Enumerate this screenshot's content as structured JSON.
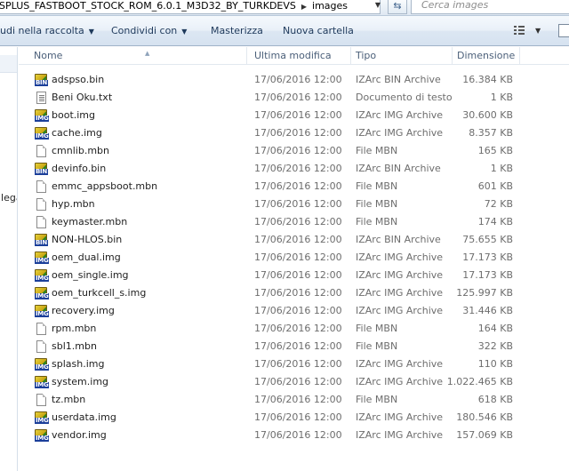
{
  "address": {
    "path_segments": [
      "SPLUS_FASTBOOT_STOCK_ROM_6.0.1_M3D32_BY_TURKDEVS",
      "images"
    ],
    "search_placeholder": "Cerca images"
  },
  "toolbar": {
    "include_label": "udi nella raccolta",
    "share_label": "Condividi con",
    "burn_label": "Masterizza",
    "new_folder_label": "Nuova cartella"
  },
  "nav": {
    "partial_label": "llega"
  },
  "columns": {
    "name": "Nome",
    "modified": "Ultima modifica",
    "type": "Tipo",
    "size": "Dimensione"
  },
  "files": [
    {
      "name": "adspso.bin",
      "date": "17/06/2016 12:00",
      "type": "IZArc BIN Archive",
      "size": "16.384 KB",
      "icon": "izarc-bin-icon"
    },
    {
      "name": "Beni Oku.txt",
      "date": "17/06/2016 12:00",
      "type": "Documento di testo",
      "size": "1 KB",
      "icon": "text-document-icon"
    },
    {
      "name": "boot.img",
      "date": "17/06/2016 12:00",
      "type": "IZArc IMG Archive",
      "size": "30.600 KB",
      "icon": "izarc-img-icon"
    },
    {
      "name": "cache.img",
      "date": "17/06/2016 12:00",
      "type": "IZArc IMG Archive",
      "size": "8.357 KB",
      "icon": "izarc-img-icon"
    },
    {
      "name": "cmnlib.mbn",
      "date": "17/06/2016 12:00",
      "type": "File MBN",
      "size": "165 KB",
      "icon": "file-icon"
    },
    {
      "name": "devinfo.bin",
      "date": "17/06/2016 12:00",
      "type": "IZArc BIN Archive",
      "size": "1 KB",
      "icon": "izarc-bin-icon"
    },
    {
      "name": "emmc_appsboot.mbn",
      "date": "17/06/2016 12:00",
      "type": "File MBN",
      "size": "601 KB",
      "icon": "file-icon"
    },
    {
      "name": "hyp.mbn",
      "date": "17/06/2016 12:00",
      "type": "File MBN",
      "size": "72 KB",
      "icon": "file-icon"
    },
    {
      "name": "keymaster.mbn",
      "date": "17/06/2016 12:00",
      "type": "File MBN",
      "size": "174 KB",
      "icon": "file-icon"
    },
    {
      "name": "NON-HLOS.bin",
      "date": "17/06/2016 12:00",
      "type": "IZArc BIN Archive",
      "size": "75.655 KB",
      "icon": "izarc-bin-icon"
    },
    {
      "name": "oem_dual.img",
      "date": "17/06/2016 12:00",
      "type": "IZArc IMG Archive",
      "size": "17.173 KB",
      "icon": "izarc-img-icon"
    },
    {
      "name": "oem_single.img",
      "date": "17/06/2016 12:00",
      "type": "IZArc IMG Archive",
      "size": "17.173 KB",
      "icon": "izarc-img-icon"
    },
    {
      "name": "oem_turkcell_s.img",
      "date": "17/06/2016 12:00",
      "type": "IZArc IMG Archive",
      "size": "125.997 KB",
      "icon": "izarc-img-icon"
    },
    {
      "name": "recovery.img",
      "date": "17/06/2016 12:00",
      "type": "IZArc IMG Archive",
      "size": "31.446 KB",
      "icon": "izarc-img-icon"
    },
    {
      "name": "rpm.mbn",
      "date": "17/06/2016 12:00",
      "type": "File MBN",
      "size": "164 KB",
      "icon": "file-icon"
    },
    {
      "name": "sbl1.mbn",
      "date": "17/06/2016 12:00",
      "type": "File MBN",
      "size": "322 KB",
      "icon": "file-icon"
    },
    {
      "name": "splash.img",
      "date": "17/06/2016 12:00",
      "type": "IZArc IMG Archive",
      "size": "110 KB",
      "icon": "izarc-img-icon"
    },
    {
      "name": "system.img",
      "date": "17/06/2016 12:00",
      "type": "IZArc IMG Archive",
      "size": "1.022.465 KB",
      "icon": "izarc-img-icon"
    },
    {
      "name": "tz.mbn",
      "date": "17/06/2016 12:00",
      "type": "File MBN",
      "size": "618 KB",
      "icon": "file-icon"
    },
    {
      "name": "userdata.img",
      "date": "17/06/2016 12:00",
      "type": "IZArc IMG Archive",
      "size": "180.546 KB",
      "icon": "izarc-img-icon"
    },
    {
      "name": "vendor.img",
      "date": "17/06/2016 12:00",
      "type": "IZArc IMG Archive",
      "size": "157.069 KB",
      "icon": "izarc-img-icon"
    }
  ]
}
